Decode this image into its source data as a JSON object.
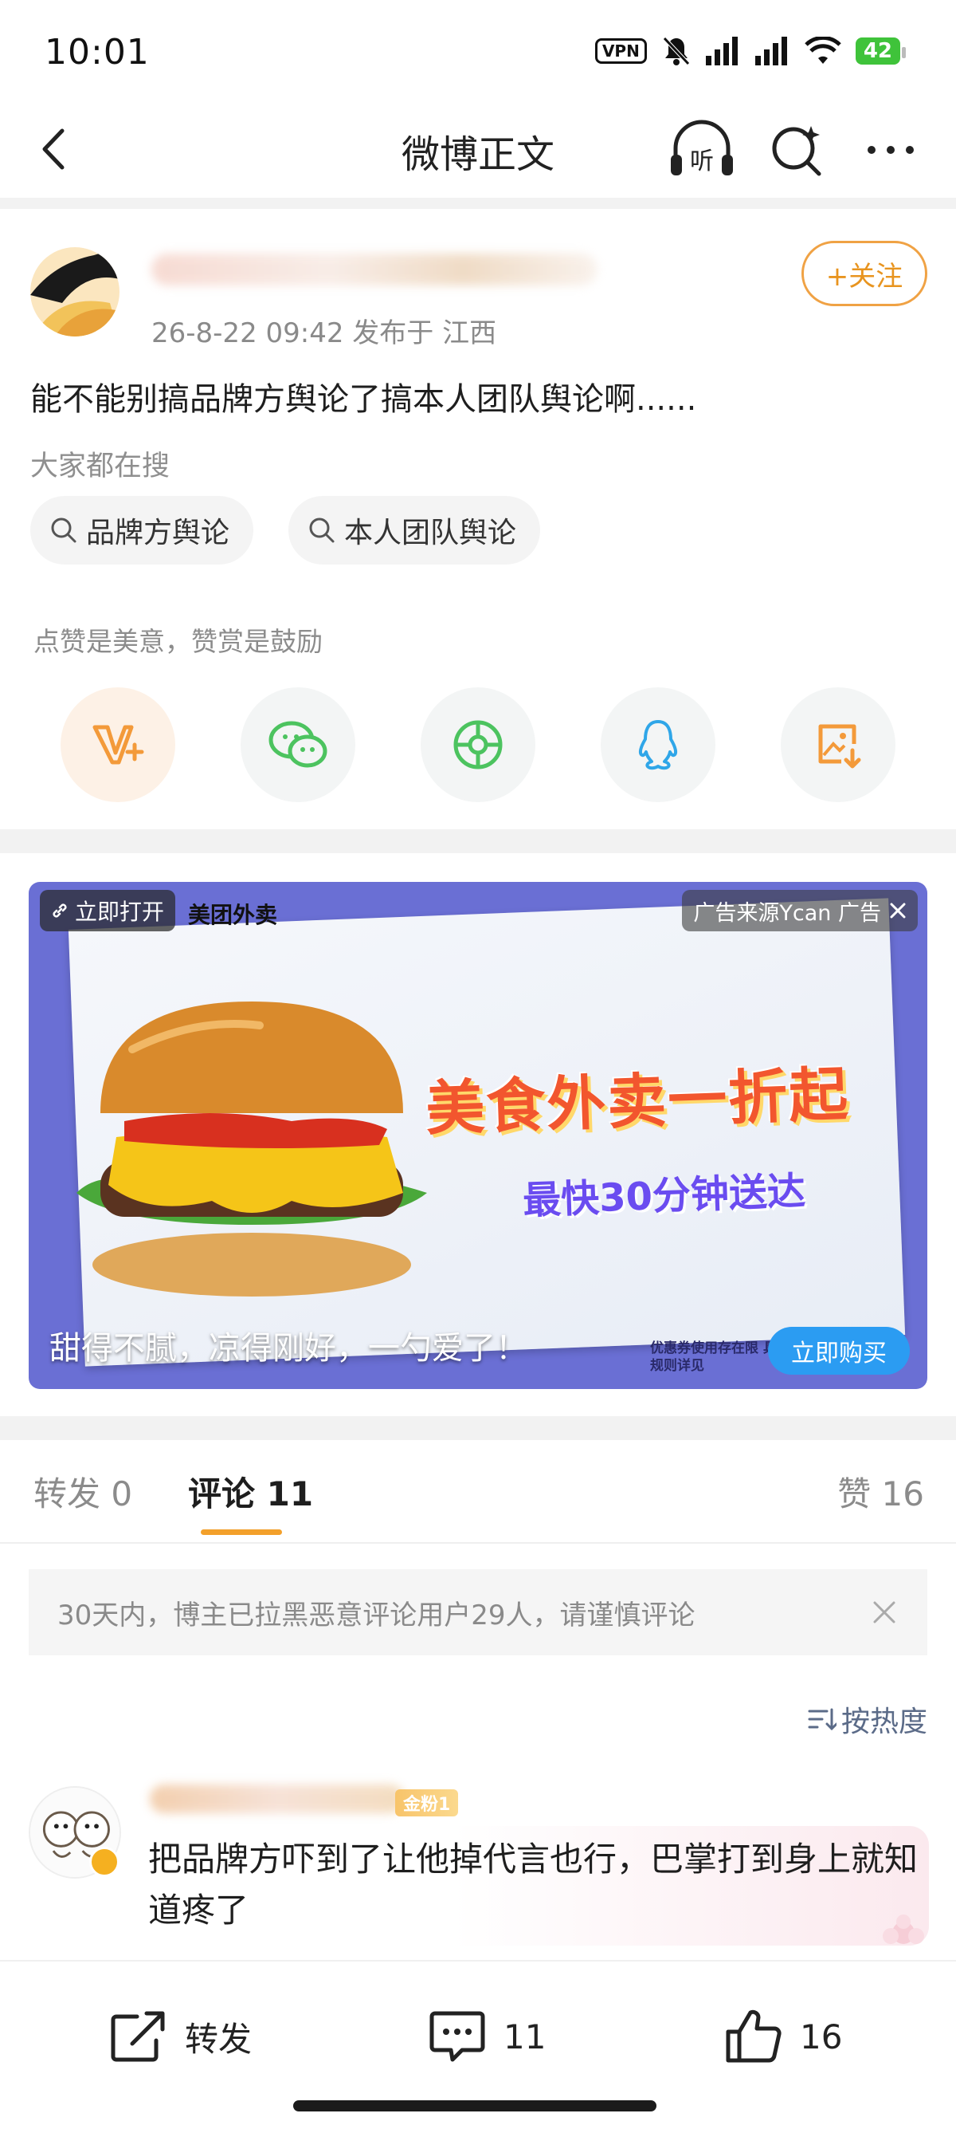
{
  "status_bar": {
    "time": "10:01",
    "vpn": "VPN",
    "battery": "42"
  },
  "nav": {
    "title": "微博正文",
    "listen_label": "听"
  },
  "post": {
    "meta": "26-8-22 09:42  发布于 江西",
    "follow_label": "+关注",
    "text": "能不能别搞品牌方舆论了搞本人团队舆论啊......",
    "search_hint": "大家都在搜",
    "tags": [
      "品牌方舆论",
      "本人团队舆论"
    ],
    "tip": "点赞是美意，赞赏是鼓励",
    "share_icons": [
      "vplus-reward-icon",
      "wechat-icon",
      "moments-icon",
      "qq-icon",
      "save-image-icon"
    ]
  },
  "ad": {
    "open_label": "立即打开",
    "brand": "美团外卖",
    "source": "广告来源Ycan 广告",
    "headline": "美食外卖一折起",
    "subline": "最快30分钟送达",
    "caption": "甜得不腻，凉得刚好，一勺爱了！",
    "fine_print": "优惠券使用存在限 具体活动规则详见",
    "buy_label": "立即购买"
  },
  "tabs": {
    "repost": "转发 0",
    "comment": "评论 11",
    "like": "赞 16"
  },
  "notice": "30天内，博主已拉黑恶意评论用户29人，请谨慎评论",
  "sort_label": "按热度",
  "comment": {
    "badge": "金粉1",
    "text": "把品牌方吓到了让他掉代言也行，巴掌打到身上就知道疼了"
  },
  "bottom_bar": {
    "repost_label": "转发",
    "comment_count": "11",
    "like_count": "16"
  },
  "colors": {
    "accent_orange": "#f3a02b",
    "follow_orange": "#e8941f",
    "ad_blue": "#2b9cf2"
  }
}
